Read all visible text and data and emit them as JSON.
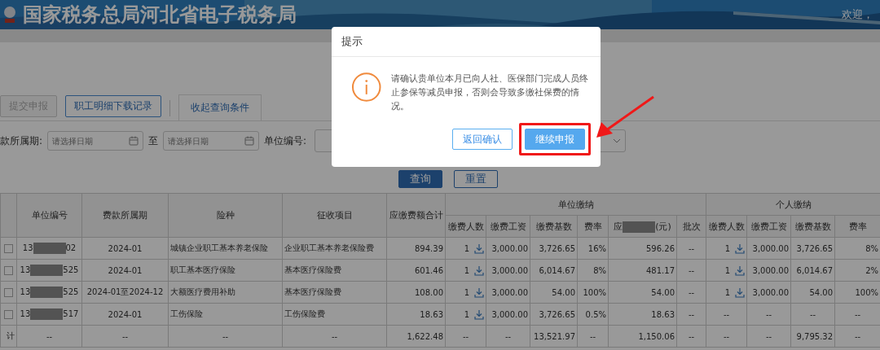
{
  "header": {
    "title": "国家税务总局河北省电子税务局",
    "welcome": "欢迎，"
  },
  "toolbar": {
    "buttons": [
      {
        "label": "提交申报",
        "disabled": true
      },
      {
        "label": "职工明细下载记录",
        "disabled": false
      }
    ],
    "tabs": [
      {
        "label": "收起查询条件",
        "selected": true
      }
    ]
  },
  "filters": {
    "period_label": "款所属期:",
    "start": {
      "placeholder": "请选择日期"
    },
    "separator": "至",
    "end": {
      "placeholder": "请选择日期"
    },
    "unit_label": "单位编号:"
  },
  "actions": [
    {
      "label": "查询",
      "kind": "primary"
    },
    {
      "label": "重置",
      "kind": "default"
    }
  ],
  "table": {
    "columns": [
      "单位编号",
      "费款所属期",
      "险种",
      "征收项目",
      "应缴费额合计"
    ],
    "groups": [
      {
        "label": "单位缴纳",
        "columns": [
          {
            "kind": "text",
            "label": "缴费人数"
          },
          {
            "kind": "text",
            "label": "缴费工资"
          },
          {
            "kind": "text",
            "label": "缴费基数"
          },
          {
            "kind": "text",
            "label": "费率"
          },
          {
            "kind": "redacted",
            "prefix": "应",
            "suffix": "(元)"
          },
          {
            "kind": "text",
            "label": "批次"
          }
        ]
      },
      {
        "label": "个人缴纳",
        "columns": [
          {
            "kind": "text",
            "label": "缴费人数"
          },
          {
            "kind": "text",
            "label": "缴费工资"
          },
          {
            "kind": "text",
            "label": "缴费基数"
          },
          {
            "kind": "text",
            "label": "费率"
          }
        ]
      }
    ],
    "rows": [
      {
        "kind": "data",
        "checked": false,
        "unit_no": {
          "prefix": "13",
          "suffix": "02"
        },
        "period": "2024-01",
        "insurance": "城镇企业职工基本养老保险",
        "item": "企业职工基本养老保险费",
        "total": "894.39",
        "unit": [
          "1",
          "3,000.00",
          "3,726.65",
          "16%",
          "596.26",
          "--"
        ],
        "personal": [
          "1",
          "3,000.00",
          "3,726.65",
          "8%"
        ]
      },
      {
        "kind": "data",
        "checked": false,
        "unit_no": {
          "prefix": "13",
          "suffix": "525"
        },
        "period": "2024-01",
        "insurance": "职工基本医疗保险",
        "item": "基本医疗保险费",
        "total": "601.46",
        "unit": [
          "1",
          "3,000.00",
          "6,014.67",
          "8%",
          "481.17",
          "--"
        ],
        "personal": [
          "1",
          "3,000.00",
          "6,014.67",
          "2%"
        ]
      },
      {
        "kind": "data",
        "checked": false,
        "unit_no": {
          "prefix": "13",
          "suffix": "525"
        },
        "period": "2024-01至2024-12",
        "insurance": "大额医疗费用补助",
        "item": "基本医疗保险费",
        "total": "108.00",
        "unit": [
          "1",
          "3,000.00",
          "54.00",
          "100%",
          "54.00",
          "--"
        ],
        "personal": [
          "1",
          "3,000.00",
          "54.00",
          "100%"
        ]
      },
      {
        "kind": "data",
        "checked": false,
        "unit_no": {
          "prefix": "13",
          "suffix": "517"
        },
        "period": "2024-01",
        "insurance": "工伤保险",
        "item": "工伤保险费",
        "total": "18.63",
        "unit": [
          "1",
          "3,000.00",
          "3,726.65",
          "0.5%",
          "18.63",
          "--"
        ],
        "personal": [
          "--",
          "--",
          "--",
          "--"
        ]
      },
      {
        "kind": "total",
        "label": "计",
        "unit_no": {
          "prefix": "--"
        },
        "period": "--",
        "insurance": "--",
        "item": "--",
        "total": "1,622.48",
        "unit": [
          "--",
          "--",
          "13,521.97",
          "--",
          "1,150.06",
          "--"
        ],
        "personal": [
          "--",
          "--",
          "9,795.32",
          "--"
        ]
      }
    ]
  },
  "dialog": {
    "title": "提示",
    "message": "请确认贵单位本月已向人社、医保部门完成人员终止参保等减员申报，否则会导致多缴社保费的情况。",
    "buttons": [
      {
        "label": "返回确认",
        "kind": "default",
        "highlighted": false
      },
      {
        "label": "继续申报",
        "kind": "primary",
        "highlighted": true
      }
    ]
  }
}
